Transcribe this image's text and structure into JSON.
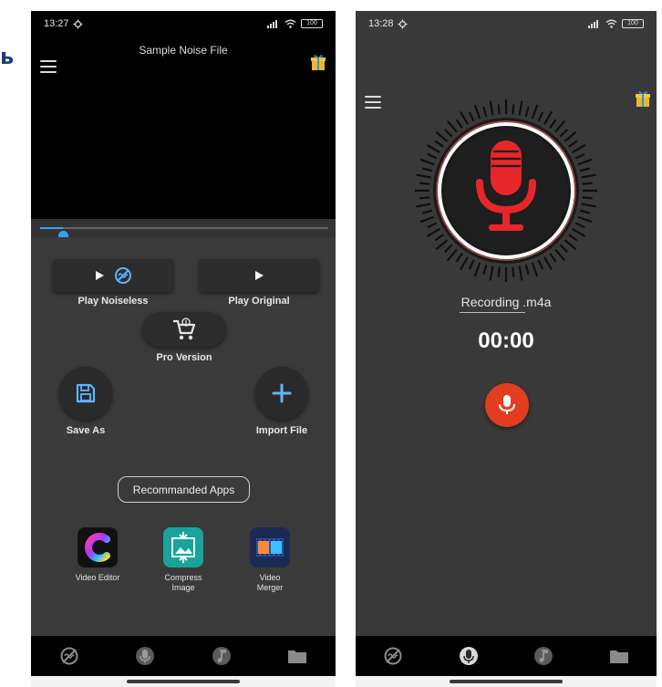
{
  "page_fragment": "ь",
  "left_screen": {
    "status_bar": {
      "time": "13:27",
      "battery": "100"
    },
    "player": {
      "title": "Sample Noise File",
      "progress": 0.08
    },
    "buttons": {
      "play_noiseless": "Play Noiseless",
      "play_original": "Play Original",
      "pro_version": "Pro Version",
      "save_as": "Save As",
      "import_file": "Import File"
    },
    "recommended_apps_label": "Recommanded Apps",
    "apps": [
      {
        "name": "Video Editor",
        "color": "#111111"
      },
      {
        "name": "Compress Image",
        "color": "#1aa39a"
      },
      {
        "name": "Video Merger",
        "color": "#1b2a55"
      }
    ]
  },
  "right_screen": {
    "status_bar": {
      "time": "13:28",
      "battery": "100"
    },
    "recording_name": "Recording .m4a",
    "timer": "00:00"
  },
  "colors": {
    "accent_blue": "#3aa0e8",
    "mic_red": "#e8262a",
    "record_button": "#e33d20",
    "background": "#3a3a3a"
  },
  "nav_icons": [
    "noise-off-icon",
    "microphone-icon",
    "music-file-icon",
    "folder-icon"
  ]
}
